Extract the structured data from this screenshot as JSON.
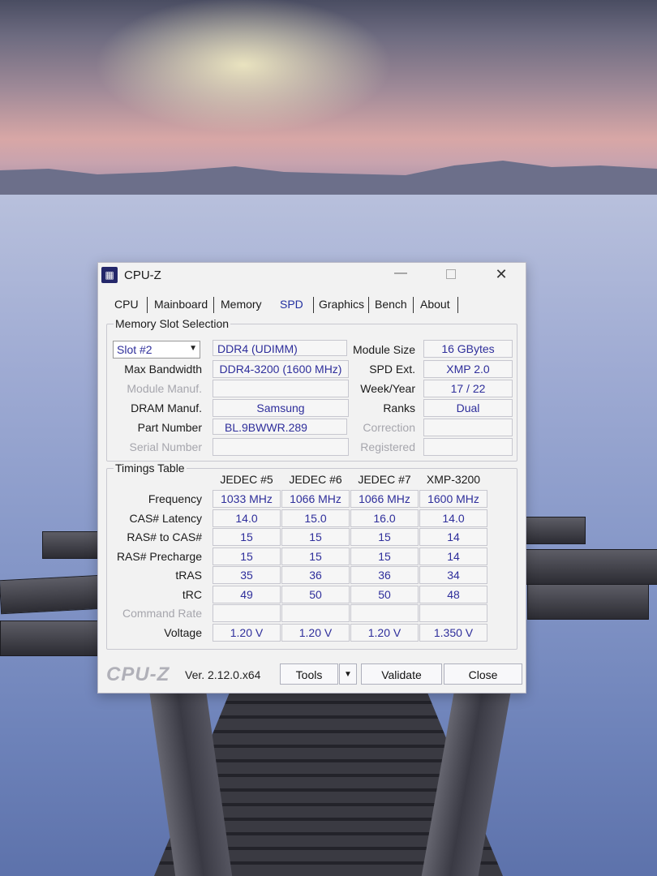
{
  "window": {
    "title": "CPU-Z",
    "min_glyph": "—",
    "close_glyph": "✕"
  },
  "tabs": [
    "CPU",
    "Mainboard",
    "Memory",
    "SPD",
    "Graphics",
    "Bench",
    "About"
  ],
  "active_tab": "SPD",
  "memory_slot": {
    "group_title": "Memory Slot Selection",
    "slot_selected": "Slot #2",
    "type": "DDR4 (UDIMM)",
    "labels": {
      "max_bandwidth": "Max Bandwidth",
      "module_manuf": "Module Manuf.",
      "dram_manuf": "DRAM Manuf.",
      "part_number": "Part Number",
      "serial_number": "Serial Number",
      "module_size": "Module Size",
      "spd_ext": "SPD Ext.",
      "week_year": "Week/Year",
      "ranks": "Ranks",
      "correction": "Correction",
      "registered": "Registered"
    },
    "values": {
      "max_bandwidth": "DDR4-3200 (1600 MHz)",
      "module_manuf": "",
      "dram_manuf": "Samsung",
      "part_number": "BL.9BWWR.289",
      "serial_number": "",
      "module_size": "16 GBytes",
      "spd_ext": "XMP 2.0",
      "week_year": "17 / 22",
      "ranks": "Dual",
      "correction": "",
      "registered": ""
    }
  },
  "timings": {
    "group_title": "Timings Table",
    "columns": [
      "JEDEC #5",
      "JEDEC #6",
      "JEDEC #7",
      "XMP-3200"
    ],
    "rows": [
      {
        "label": "Frequency",
        "values": [
          "1033 MHz",
          "1066 MHz",
          "1066 MHz",
          "1600 MHz"
        ],
        "dim": false
      },
      {
        "label": "CAS# Latency",
        "values": [
          "14.0",
          "15.0",
          "16.0",
          "14.0"
        ],
        "dim": false
      },
      {
        "label": "RAS# to CAS#",
        "values": [
          "15",
          "15",
          "15",
          "14"
        ],
        "dim": false
      },
      {
        "label": "RAS# Precharge",
        "values": [
          "15",
          "15",
          "15",
          "14"
        ],
        "dim": false
      },
      {
        "label": "tRAS",
        "values": [
          "35",
          "36",
          "36",
          "34"
        ],
        "dim": false
      },
      {
        "label": "tRC",
        "values": [
          "49",
          "50",
          "50",
          "48"
        ],
        "dim": false
      },
      {
        "label": "Command Rate",
        "values": [
          "",
          "",
          "",
          ""
        ],
        "dim": true
      },
      {
        "label": "Voltage",
        "values": [
          "1.20 V",
          "1.20 V",
          "1.20 V",
          "1.350 V"
        ],
        "dim": false
      }
    ]
  },
  "footer": {
    "brand": "CPU-Z",
    "version": "Ver. 2.12.0.x64",
    "tools_label": "Tools",
    "validate_label": "Validate",
    "close_label": "Close"
  },
  "colors": {
    "value_text": "#2e2e9b",
    "active_tab": "#2230a0",
    "window_bg": "#f2f2f2"
  }
}
